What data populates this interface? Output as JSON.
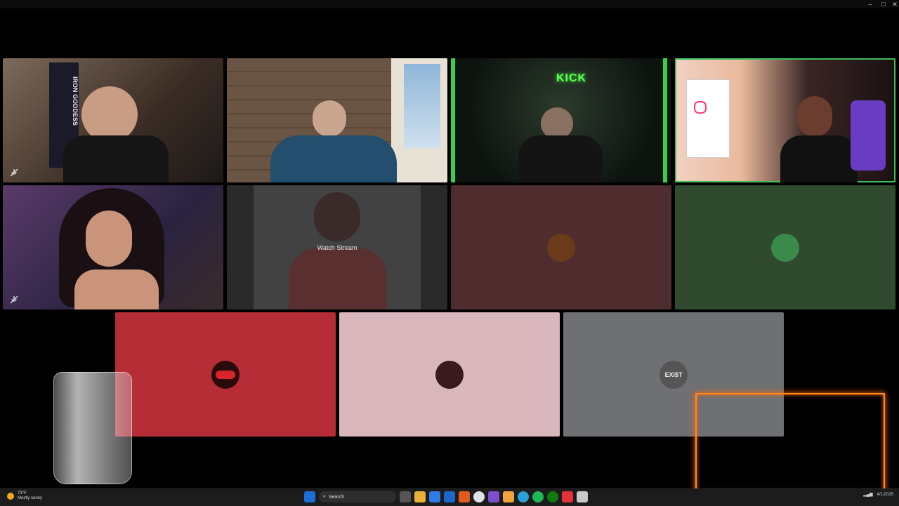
{
  "window": {
    "controls": [
      "–",
      "□",
      "✕"
    ]
  },
  "tiles": [
    {
      "id": "p1",
      "type": "video",
      "speaking": false,
      "muted": true,
      "bg": "#6b5444",
      "shirt_text": "IRON GODDESS"
    },
    {
      "id": "p2",
      "type": "video",
      "speaking": false,
      "muted": false,
      "bg": "#5b4a3c"
    },
    {
      "id": "p3",
      "type": "video",
      "speaking": false,
      "muted": false,
      "bg": "#13221a",
      "sign": "KICK"
    },
    {
      "id": "p4",
      "type": "video",
      "speaking": true,
      "muted": false,
      "bg": "#3a2a2a"
    },
    {
      "id": "p5",
      "type": "video",
      "speaking": false,
      "muted": true,
      "bg": "#3a3346"
    },
    {
      "id": "p6",
      "type": "stream",
      "label": "Watch Stream",
      "bg": "#3d3d3d"
    },
    {
      "id": "p7",
      "type": "avatar",
      "bg": "#4f2d2f",
      "avatar_color": "#6b3b1a"
    },
    {
      "id": "p8",
      "type": "avatar",
      "bg": "#2f4a2f",
      "avatar_color": "#3a8a4a"
    },
    {
      "id": "p9",
      "type": "avatar",
      "bg": "#b62d35",
      "avatar_color": "#2b0a0c"
    },
    {
      "id": "p10",
      "type": "avatar",
      "bg": "#d9b7bd",
      "avatar_color": "#3a1a1f"
    },
    {
      "id": "p11",
      "type": "avatar",
      "bg": "#6f7074",
      "avatar_text": "EXI$T",
      "avatar_color": "#d9d9d9"
    }
  ],
  "taskbar": {
    "weather_temp": "73°F",
    "weather_desc": "Mostly sunny",
    "search_label": "Search",
    "date": "4/1/2025"
  },
  "colors": {
    "speaking_outline": "#3fbf5c",
    "overlay_glow": "#ff8a1e"
  }
}
